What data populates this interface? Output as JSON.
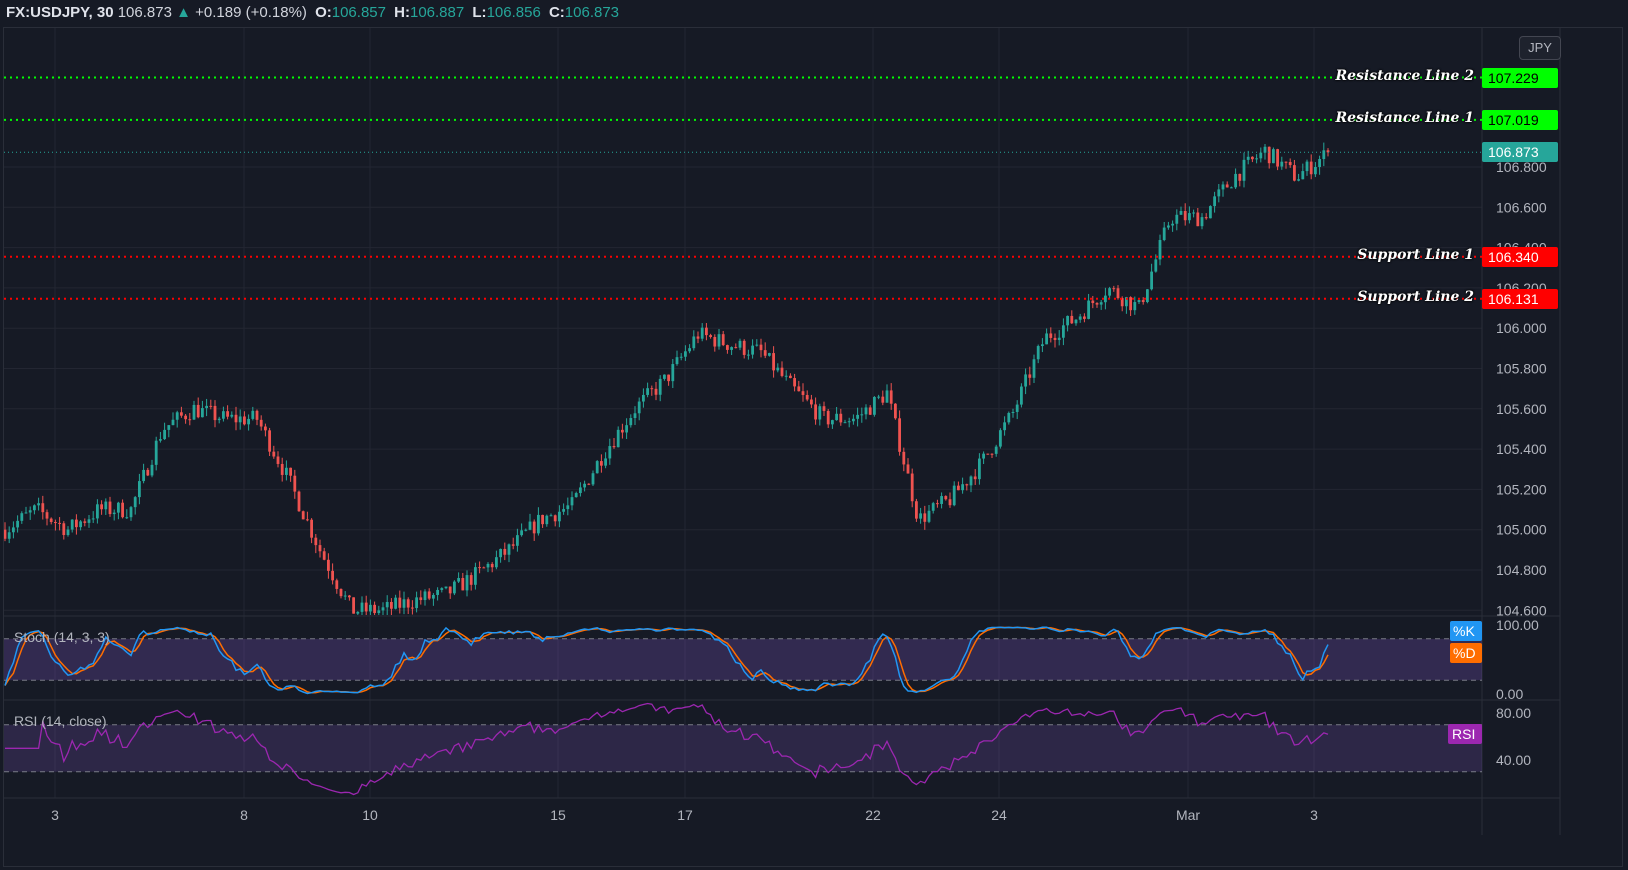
{
  "header": {
    "symbol": "FX:USDJPY, 30",
    "price": "106.873",
    "change": "+0.189 (+0.18%)",
    "o_label": "O:",
    "o": "106.857",
    "h_label": "H:",
    "h": "106.887",
    "l_label": "L:",
    "l": "106.856",
    "c_label": "C:",
    "c": "106.873"
  },
  "currency_button": "JPY",
  "colors": {
    "background": "#161a25",
    "up": "#26a69a",
    "down": "#ef5350",
    "resistance": "#00ff00",
    "support": "#ff0000",
    "stoch_k": "#2196f3",
    "stoch_d": "#ff6d00",
    "rsi": "#9c27b0"
  },
  "chart_data": [
    {
      "type": "candlestick",
      "title": "FX:USDJPY, 30",
      "ylim": [
        104.585,
        107.49
      ],
      "y_ticks": [
        "106.800",
        "106.600",
        "106.400",
        "106.200",
        "106.000",
        "105.800",
        "105.600",
        "105.400",
        "105.200",
        "105.000",
        "104.800",
        "104.600"
      ],
      "x_ticks": [
        "3",
        "8",
        "10",
        "15",
        "17",
        "22",
        "24",
        "Mar",
        "3"
      ],
      "close_path": [
        105.0,
        105.1,
        105.0,
        105.1,
        105.1,
        105.5,
        105.6,
        105.55,
        105.55,
        105.25,
        104.9,
        104.6,
        104.6,
        104.65,
        104.68,
        104.78,
        104.9,
        105.05,
        105.12,
        105.38,
        105.6,
        105.75,
        105.97,
        105.92,
        105.88,
        105.7,
        105.55,
        105.55,
        105.68,
        105.05,
        105.15,
        105.33,
        105.58,
        105.95,
        106.05,
        106.2,
        106.1,
        106.55,
        106.55,
        106.75,
        106.88,
        106.75,
        106.87
      ],
      "last_price": "106.873",
      "horizontal_lines": [
        {
          "label": "Resistance Line 2",
          "price": "107.229",
          "kind": "resistance"
        },
        {
          "label": "Resistance Line 1",
          "price": "107.019",
          "kind": "resistance"
        },
        {
          "label": "Support Line 1",
          "price": "106.340",
          "kind": "support"
        },
        {
          "label": "Support Line 2",
          "price": "106.131",
          "kind": "support"
        }
      ]
    },
    {
      "type": "line",
      "title": "Stoch (14, 3, 3)",
      "ylim": [
        0,
        100
      ],
      "y_ticks": [
        "100.00",
        "0.00"
      ],
      "bands": [
        80,
        20
      ],
      "series": [
        {
          "name": "%K"
        },
        {
          "name": "%D"
        }
      ]
    },
    {
      "type": "line",
      "title": "RSI (14, close)",
      "ylim": [
        20,
        90
      ],
      "y_ticks": [
        "80.00",
        "40.00"
      ],
      "bands": [
        70,
        30
      ],
      "series": [
        {
          "name": "RSI"
        }
      ]
    }
  ]
}
